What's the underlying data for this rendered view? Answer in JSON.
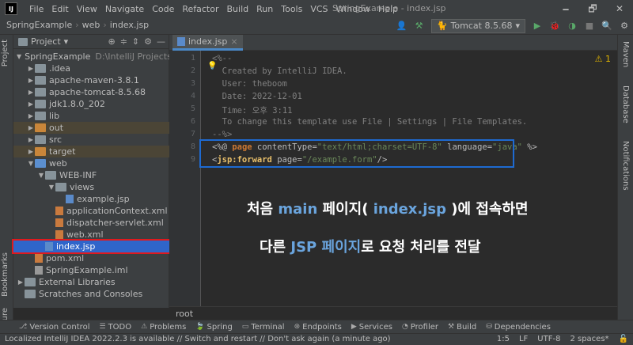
{
  "titlebar": {
    "menu": [
      "File",
      "Edit",
      "View",
      "Navigate",
      "Code",
      "Refactor",
      "Build",
      "Run",
      "Tools",
      "VCS",
      "Window",
      "Help"
    ],
    "window_title": "SpringExample - index.jsp",
    "controls": [
      "🗕",
      "🗗",
      "✕"
    ]
  },
  "navbar": {
    "breadcrumbs": [
      "SpringExample",
      "web",
      "index.jsp"
    ],
    "run_config": "Tomcat 8.5.68"
  },
  "project": {
    "header": "Project",
    "tree": [
      {
        "label": "SpringExample",
        "path": "D:\\IntelliJ Projects\\Spri",
        "indent": 0,
        "arrow": "▼",
        "icon": "folder blue"
      },
      {
        "label": ".idea",
        "indent": 1,
        "arrow": "▶",
        "icon": "folder"
      },
      {
        "label": "apache-maven-3.8.1",
        "indent": 1,
        "arrow": "▶",
        "icon": "folder"
      },
      {
        "label": "apache-tomcat-8.5.68",
        "indent": 1,
        "arrow": "▶",
        "icon": "folder"
      },
      {
        "label": "jdk1.8.0_202",
        "indent": 1,
        "arrow": "▶",
        "icon": "folder"
      },
      {
        "label": "lib",
        "indent": 1,
        "arrow": "▶",
        "icon": "folder"
      },
      {
        "label": "out",
        "indent": 1,
        "arrow": "▶",
        "icon": "folder orange",
        "brown": true
      },
      {
        "label": "src",
        "indent": 1,
        "arrow": "▶",
        "icon": "folder"
      },
      {
        "label": "target",
        "indent": 1,
        "arrow": "▶",
        "icon": "folder orange",
        "brown": true
      },
      {
        "label": "web",
        "indent": 1,
        "arrow": "▼",
        "icon": "folder blue"
      },
      {
        "label": "WEB-INF",
        "indent": 2,
        "arrow": "▼",
        "icon": "folder"
      },
      {
        "label": "views",
        "indent": 3,
        "arrow": "▼",
        "icon": "folder"
      },
      {
        "label": "example.jsp",
        "indent": 4,
        "arrow": "",
        "icon": "file jsp"
      },
      {
        "label": "applicationContext.xml",
        "indent": 3,
        "arrow": "",
        "icon": "file xml"
      },
      {
        "label": "dispatcher-servlet.xml",
        "indent": 3,
        "arrow": "",
        "icon": "file xml"
      },
      {
        "label": "web.xml",
        "indent": 3,
        "arrow": "",
        "icon": "file xml"
      },
      {
        "label": "index.jsp",
        "indent": 2,
        "arrow": "",
        "icon": "file jsp",
        "selected": true
      },
      {
        "label": "pom.xml",
        "indent": 1,
        "arrow": "",
        "icon": "file xml"
      },
      {
        "label": "SpringExample.iml",
        "indent": 1,
        "arrow": "",
        "icon": "file iml"
      },
      {
        "label": "External Libraries",
        "indent": 0,
        "arrow": "▶",
        "icon": "folder"
      },
      {
        "label": "Scratches and Consoles",
        "indent": 0,
        "arrow": "",
        "icon": "folder"
      }
    ]
  },
  "left_tabs": [
    "Project",
    "Bookmarks",
    "Structure"
  ],
  "right_tabs": [
    "Maven",
    "Database",
    "Notifications"
  ],
  "editor": {
    "tab_label": "index.jsp",
    "warning": "⚠ 1",
    "lines": [
      {
        "n": "1",
        "text": "<%--"
      },
      {
        "n": "2",
        "text": "  Created by IntelliJ IDEA."
      },
      {
        "n": "3",
        "text": "  User: theboom"
      },
      {
        "n": "4",
        "text": "  Date: 2022-12-01"
      },
      {
        "n": "5",
        "text": "  Time: 오후 3:11"
      },
      {
        "n": "6",
        "text": "  To change this template use File | Settings | File Templates."
      },
      {
        "n": "7",
        "text": "--%>"
      },
      {
        "n": "8",
        "text": ""
      },
      {
        "n": "9",
        "text": ""
      }
    ],
    "line8": {
      "p1": "<%@ ",
      "kw": "page",
      "a1": " contentType=",
      "s1": "\"text/html;charset=UTF-8\"",
      "a2": " language=",
      "s2": "\"java\"",
      "end": " %>"
    },
    "line9": {
      "p1": "<",
      "tag": "jsp:forward",
      "a1": " page=",
      "s1": "\"/example.form\"",
      "end": "/>"
    },
    "overlay1": {
      "a": "처음 ",
      "b": "main",
      "c": " 페이지( ",
      "d": "index.jsp",
      "e": " )에 접속하면"
    },
    "overlay2": {
      "a": "다른 ",
      "b": "JSP 페이지",
      "c": "로 요청 처리를 전달"
    },
    "root_label": "root"
  },
  "toolbar": [
    "Version Control",
    "TODO",
    "Problems",
    "Spring",
    "Terminal",
    "Endpoints",
    "Services",
    "Profiler",
    "Build",
    "Dependencies"
  ],
  "statusbar": {
    "message": "Localized IntelliJ IDEA 2022.2.3 is available // Switch and restart // Don't ask again (a minute ago)",
    "position": "1:5",
    "line_sep": "LF",
    "encoding": "UTF-8",
    "indent": "2 spaces*"
  }
}
